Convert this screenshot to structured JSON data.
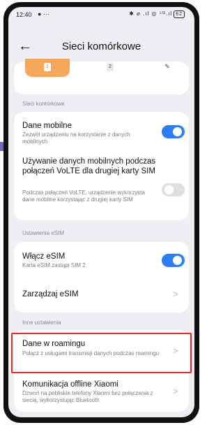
{
  "status_bar": {
    "time": "12:40",
    "left_icons": "● ···",
    "right_icons": "✱ ⌀ .ıl ◎ ⁵ᴳ.ıl",
    "battery": "62"
  },
  "header": {
    "title": "Sieci komórkowe"
  },
  "sim_tabs": [
    "1",
    "2",
    "✎"
  ],
  "section_mobile": {
    "label": "Sieci komórkowe",
    "mobile_data": {
      "title": "Dane mobilne",
      "subtitle": "Zezwól urządzeniu na korzystanie z danych mobilnych",
      "enabled": true
    },
    "volte": {
      "title": "Używanie danych mobilnych podczas połączeń VoLTE dla drugiej karty SIM",
      "subtitle": "Podczas połączeń VoLTE, urządzenie wykorzysta dane mobilne korzystając z drugiej karty SIM",
      "enabled": false
    }
  },
  "section_esim": {
    "label": "Ustawienia eSIM",
    "enable_esim": {
      "title": "Włącz eSIM",
      "subtitle": "Karta eSIM zastąpi SIM 2",
      "enabled": true
    },
    "manage_esim": {
      "title": "Zarządzaj eSIM"
    }
  },
  "section_other": {
    "label": "Inne ustawienia",
    "roaming": {
      "title": "Dane w roamingu",
      "subtitle": "Połącz z usługami transmisji danych podczas roamingu"
    },
    "offline": {
      "title": "Komunikacja offline Xiaomi",
      "subtitle": "Dzwoń na pobliskie telefony Xiaomi bez połączenia z siecią, wykorzystując Bluetooth"
    }
  },
  "colors": {
    "accent": "#2e7cf6",
    "sim_tab": "#f5a85a",
    "highlight": "#e0282f"
  }
}
